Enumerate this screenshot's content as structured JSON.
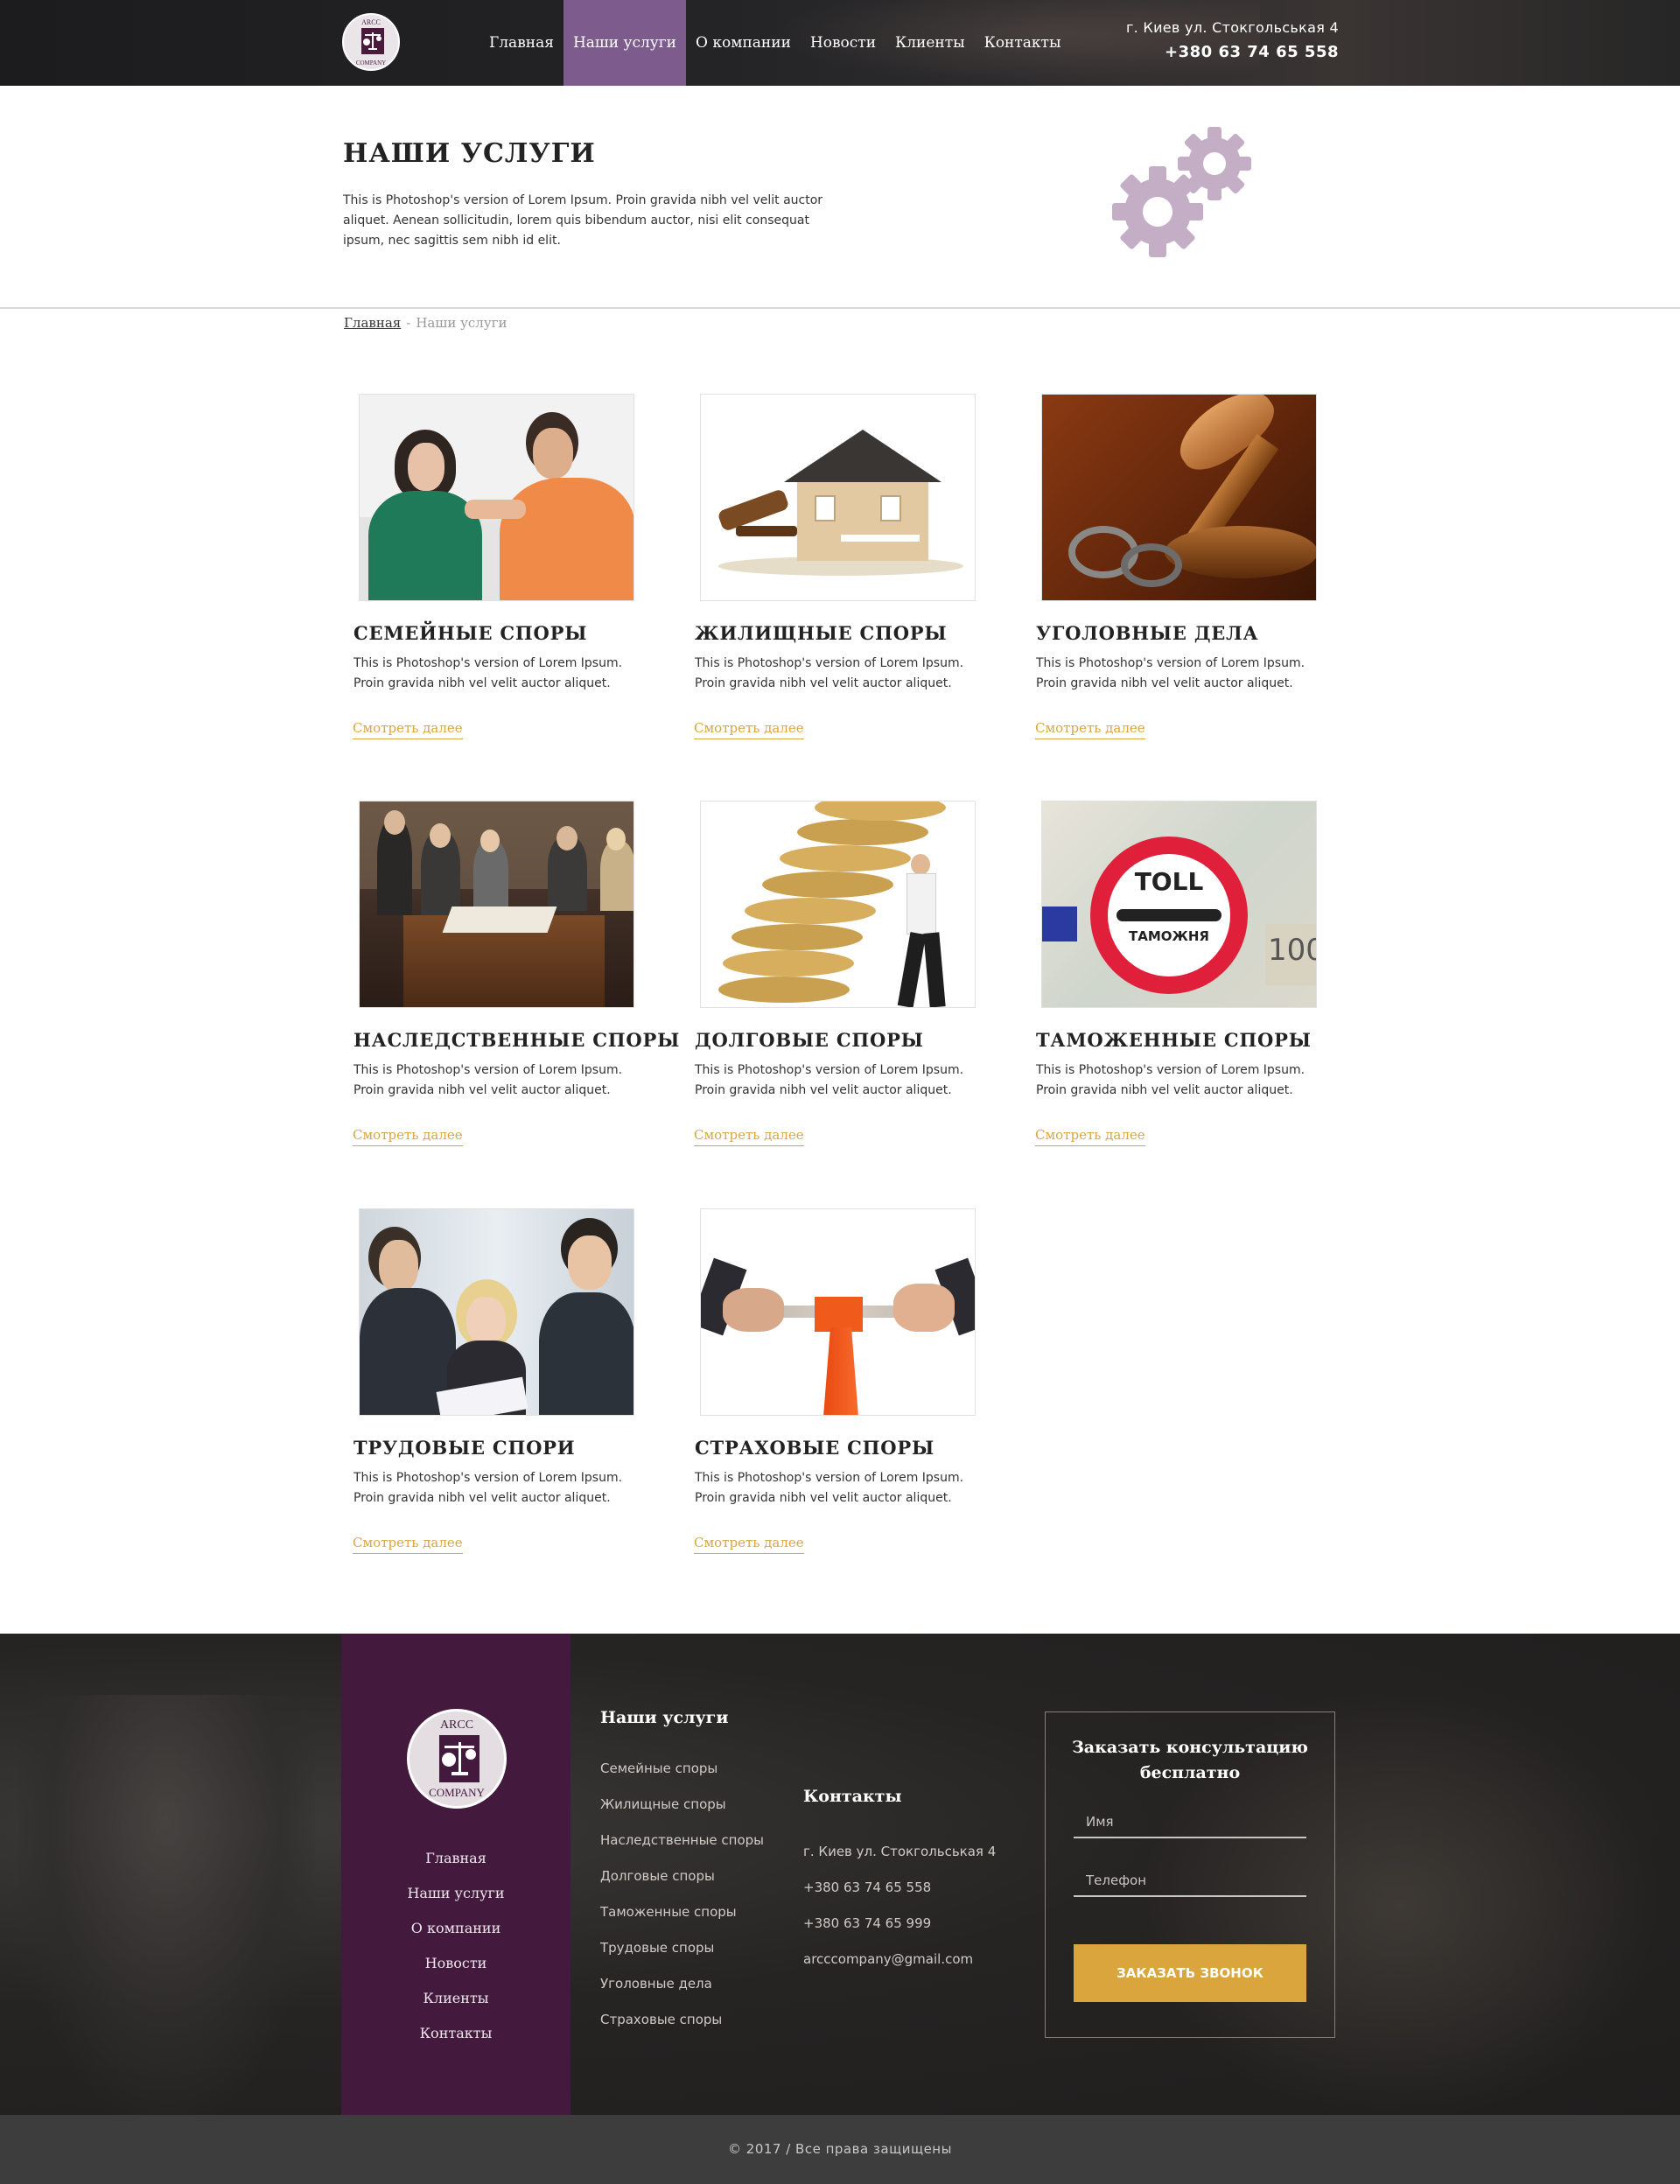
{
  "header": {
    "logo_top": "ARCC",
    "logo_bottom": "COMPANY",
    "nav": [
      "Главная",
      "Наши услуги",
      "О компании",
      "Новости",
      "Клиенты",
      "Контакты"
    ],
    "active_nav": "Наши услуги",
    "address": "г. Киев ул. Стокгольськая 4",
    "phone": "+380 63 74 65 558",
    "accent_color": "#7d5c8d"
  },
  "hero": {
    "title": "НАШИ УСЛУГИ",
    "text": "This is Photoshop's version  of Lorem Ipsum. Proin gravida nibh vel velit auctor aliquet. Aenean sollicitudin, lorem quis bibendum auctor, nisi elit consequat ipsum, nec sagittis sem nibh id elit.",
    "icon": "gears-icon"
  },
  "breadcrumb": {
    "home": "Главная",
    "separator": "-",
    "current": "Наши услуги"
  },
  "services": [
    {
      "title": "СЕМЕЙНЫЕ СПОРЫ",
      "text": "This is Photoshop's version  of Lorem Ipsum. Proin gravida nibh vel velit auctor aliquet.",
      "more": "Смотреть далее"
    },
    {
      "title": "ЖИЛИЩНЫЕ СПОРЫ",
      "text": "This is Photoshop's version  of Lorem Ipsum. Proin gravida nibh vel velit auctor aliquet.",
      "more": "Смотреть далее"
    },
    {
      "title": "УГОЛОВНЫЕ ДЕЛА",
      "text": "This is Photoshop's version  of Lorem Ipsum. Proin gravida nibh vel velit auctor aliquet.",
      "more": "Смотреть далее"
    },
    {
      "title": "НАСЛЕДСТВЕННЫЕ СПОРЫ",
      "text": "This is Photoshop's version  of Lorem Ipsum. Proin gravida nibh vel velit auctor aliquet.",
      "more": "Смотреть далее"
    },
    {
      "title": "ДОЛГОВЫЕ СПОРЫ",
      "text": "This is Photoshop's version  of Lorem Ipsum. Proin gravida nibh vel velit auctor aliquet.",
      "more": "Смотреть далее"
    },
    {
      "title": "ТАМОЖЕННЫЕ СПОРЫ",
      "text": "This is Photoshop's version  of Lorem Ipsum. Proin gravida nibh vel velit auctor aliquet.",
      "more": "Смотреть далее",
      "sign_top": "TOLL",
      "sign_bottom": "ТАМОЖНЯ",
      "note": "100"
    },
    {
      "title": "ТРУДОВЫЕ СПОРИ",
      "text": "This is Photoshop's version  of Lorem Ipsum. Proin gravida nibh vel velit auctor aliquet.",
      "more": "Смотреть далее"
    },
    {
      "title": "СТРАХОВЫЕ СПОРЫ",
      "text": "This is Photoshop's version  of Lorem Ipsum. Proin gravida nibh vel velit auctor aliquet.",
      "more": "Смотреть далее"
    }
  ],
  "footer": {
    "logo_top": "ARCC",
    "logo_bottom": "COMPANY",
    "side_nav": [
      "Главная",
      "Наши услуги",
      "О компании",
      "Новости",
      "Клиенты",
      "Контакты"
    ],
    "services_title": "Наши услуги",
    "services_list": [
      "Семейные споры",
      "Жилищные споры",
      "Наследственные споры",
      "Долговые споры",
      "Таможенные споры",
      "Трудовые споры",
      "Уголовные дела",
      "Страховые споры"
    ],
    "contacts_title": "Контакты",
    "contacts": [
      "г. Киев ул. Стокгольськая 4",
      "+380 63 74 65 558",
      "+380 63 74 65 999",
      "arcccompany@gmail.com"
    ],
    "form_title_1": "Заказать консультацию",
    "form_title_2": "бесплатно",
    "name_placeholder": "Имя",
    "phone_placeholder": "Телефон",
    "button": "ЗАКАЗАТЬ ЗВОНОК",
    "button_color": "#d9a53c",
    "side_color": "#431a3d"
  },
  "copyright": "©  2017 / Все права защищены"
}
